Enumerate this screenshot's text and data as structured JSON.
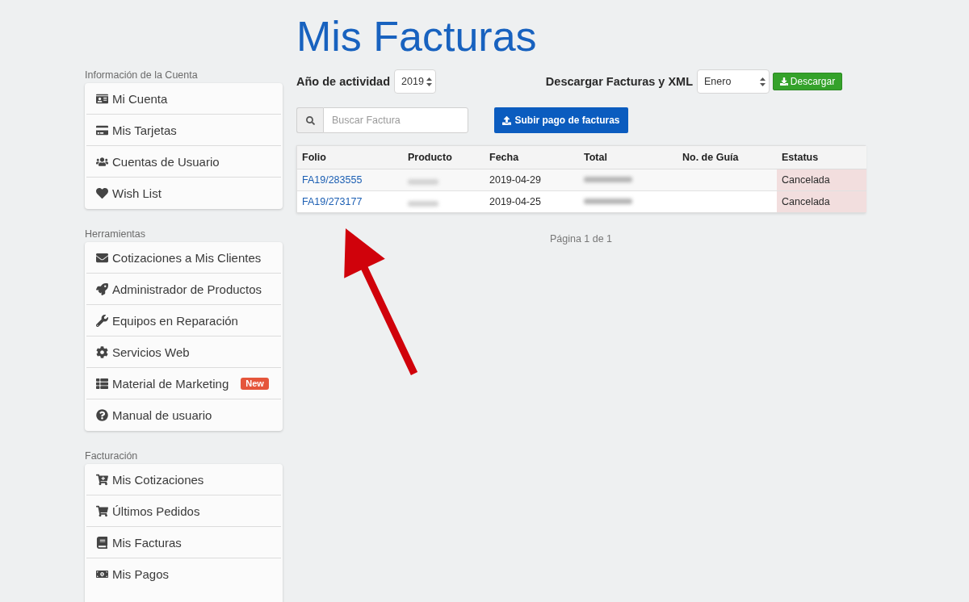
{
  "page": {
    "title": "Mis Facturas"
  },
  "sidebar": {
    "sections": [
      {
        "heading": "Información de la Cuenta",
        "items": [
          {
            "label": "Mi Cuenta"
          },
          {
            "label": "Mis Tarjetas"
          },
          {
            "label": "Cuentas de Usuario"
          },
          {
            "label": "Wish List"
          }
        ]
      },
      {
        "heading": "Herramientas",
        "items": [
          {
            "label": "Cotizaciones a Mis Clientes"
          },
          {
            "label": "Administrador de Productos"
          },
          {
            "label": "Equipos en Reparación"
          },
          {
            "label": "Servicios Web"
          },
          {
            "label": "Material de Marketing",
            "badge": "New"
          },
          {
            "label": "Manual de usuario"
          }
        ]
      },
      {
        "heading": "Facturación",
        "items": [
          {
            "label": "Mis Cotizaciones"
          },
          {
            "label": "Últimos Pedidos"
          },
          {
            "label": "Mis Facturas"
          },
          {
            "label": "Mis Pagos"
          }
        ]
      }
    ]
  },
  "filters": {
    "year_label": "Año de actividad",
    "year": "2019",
    "download_label": "Descargar Facturas y XML",
    "month": "Enero",
    "download_button": "Descargar"
  },
  "search": {
    "placeholder": "Buscar Factura"
  },
  "upload_button": "Subir pago de facturas",
  "table": {
    "columns": [
      "Folio",
      "Producto",
      "Fecha",
      "Total",
      "No. de Guía",
      "Estatus"
    ],
    "rows": [
      {
        "folio": "FA19/283555",
        "product_blurred": true,
        "fecha": "2019-04-29",
        "total_blurred": true,
        "estatus": "Cancelada",
        "color": "#f2dede"
      },
      {
        "folio": "FA19/273177",
        "product_blurred": true,
        "fecha": "2019-04-25",
        "total_blurred": true,
        "estatus": "Cancelada",
        "color": "#f2dede"
      }
    ]
  },
  "pagination": "Página 1 de 1"
}
